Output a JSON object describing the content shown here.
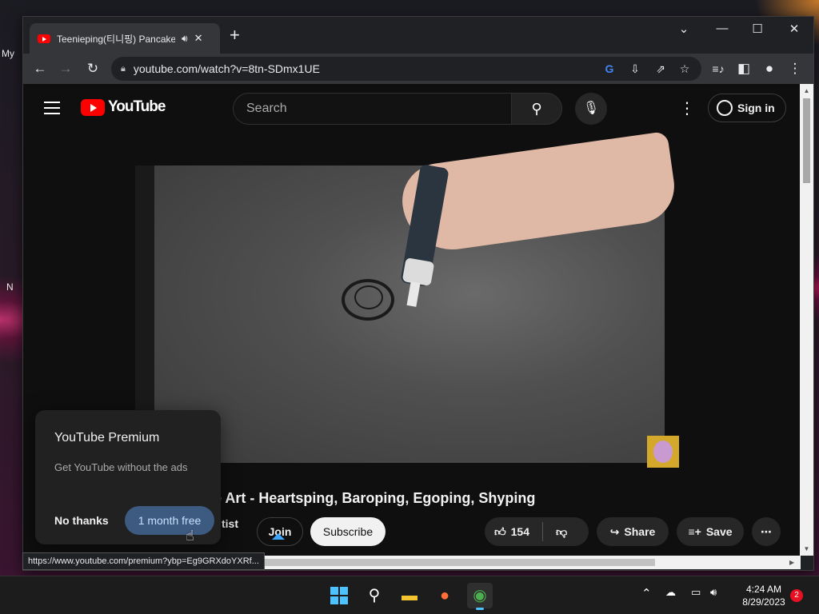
{
  "desktop": {
    "left_text_1": "My",
    "left_text_2": "N"
  },
  "browser": {
    "tab": {
      "title": "Teenieping(티니핑) Pancake",
      "audio_icon": "speaker-icon",
      "close_label": "✕"
    },
    "new_tab_label": "+",
    "window_controls": {
      "dropdown": "⌄",
      "minimize": "—",
      "maximize": "☐",
      "close": "✕"
    },
    "url": "youtube.com/watch?v=8tn-SDmx1UE"
  },
  "youtube": {
    "logo_text": "YouTube",
    "search_placeholder": "Search",
    "sign_in_label": "Sign in",
    "video": {
      "title_fragment": "ke Art - Heartsping, Baroping, Egoping, Shyping",
      "channel_fragment": "tist"
    },
    "actions": {
      "join": "Join",
      "subscribe": "Subscribe",
      "like_count": "154",
      "share": "Share",
      "save": "Save"
    },
    "premium_popup": {
      "title": "YouTube Premium",
      "description": "Get YouTube without the ads",
      "dismiss_label": "No thanks",
      "cta_label": "1 month free"
    }
  },
  "status_bar_url": "https://www.youtube.com/premium?ybp=Eg9GRXdoYXRf...",
  "taskbar": {
    "time": "4:24 AM",
    "date": "8/29/2023",
    "notification_count": "2"
  },
  "colors": {
    "youtube_red": "#ff0000",
    "accent_blue": "#3ea6ff",
    "page_bg": "#0f0f0f"
  }
}
